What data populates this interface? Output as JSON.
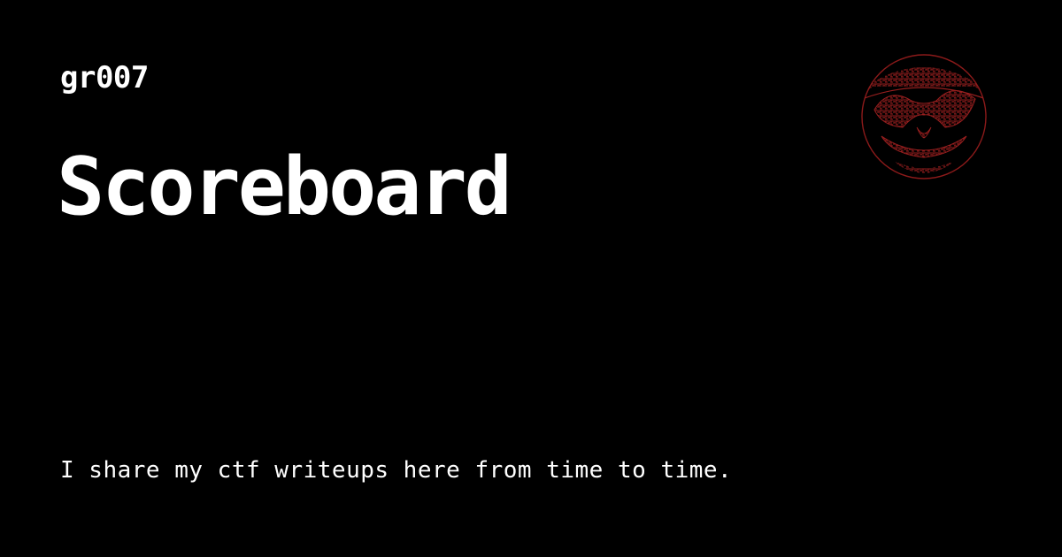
{
  "site": {
    "name": "gr007"
  },
  "page": {
    "title": "Scoreboard",
    "description": "I share my ctf writeups here from time to time."
  },
  "logo": {
    "icon": "pirate-mask-logo-icon",
    "color": "#8b1a1a"
  },
  "colors": {
    "background": "#000000",
    "text": "#ffffff"
  }
}
